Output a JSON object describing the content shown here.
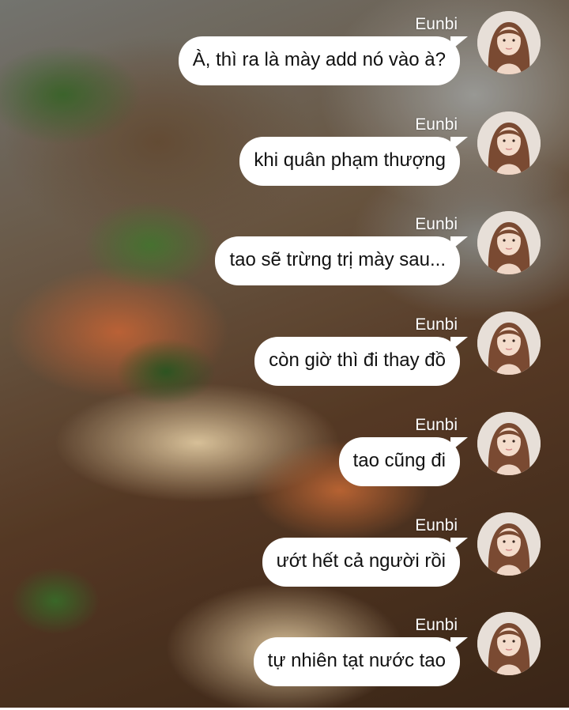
{
  "chat": {
    "messages": [
      {
        "sender": "Eunbi",
        "text": "À, thì ra là mày add nó vào à?"
      },
      {
        "sender": "Eunbi",
        "text": "khi quân phạm thượng"
      },
      {
        "sender": "Eunbi",
        "text": "tao sẽ trừng trị mày sau..."
      },
      {
        "sender": "Eunbi",
        "text": "còn giờ thì đi thay đồ"
      },
      {
        "sender": "Eunbi",
        "text": "tao cũng đi"
      },
      {
        "sender": "Eunbi",
        "text": "ướt hết cả người rồi"
      },
      {
        "sender": "Eunbi",
        "text": "tự nhiên tạt nước tao"
      }
    ]
  },
  "colors": {
    "bubble": "#ffffff",
    "text": "#111111",
    "sender_name": "#ffffff"
  },
  "icons": {
    "avatar": "profile-avatar-icon"
  }
}
